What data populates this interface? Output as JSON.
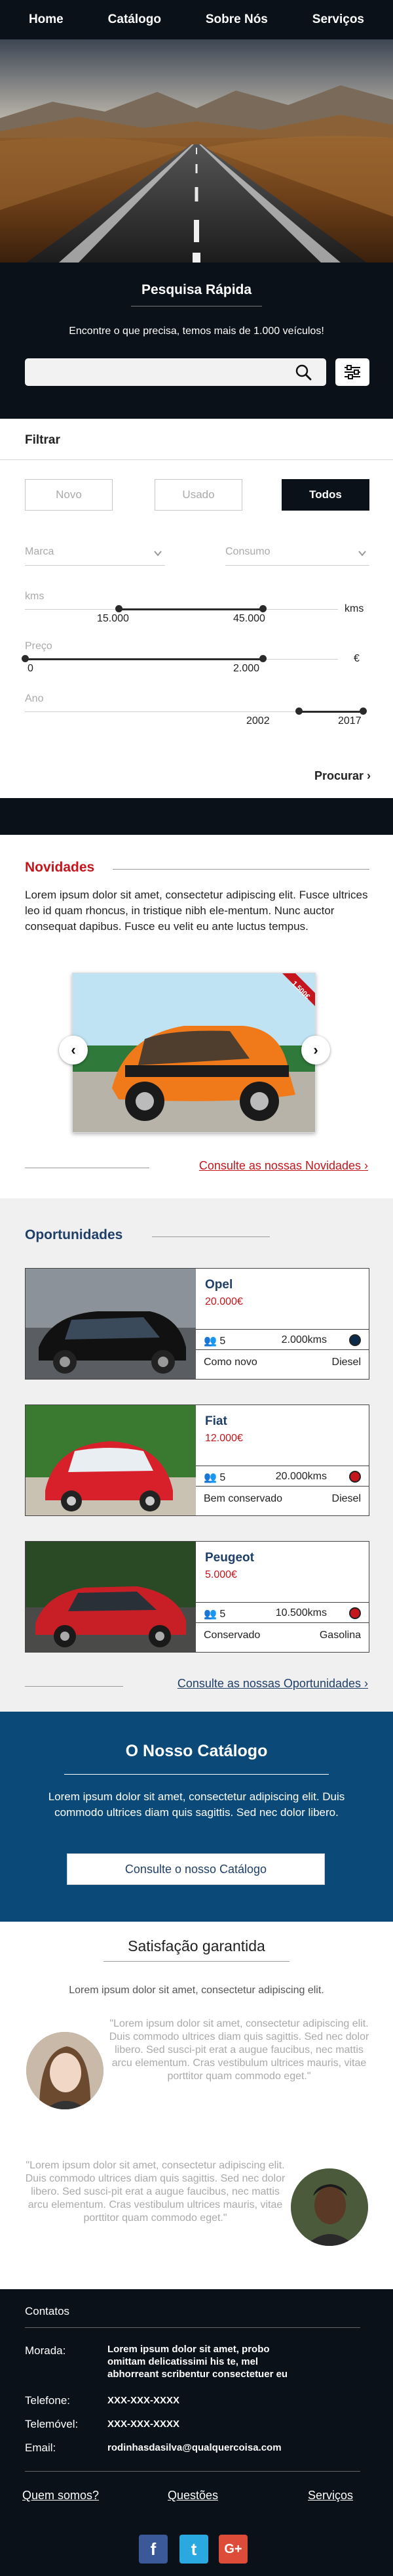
{
  "nav": {
    "items": [
      "Home",
      "Catálogo",
      "Sobre Nós",
      "Serviços"
    ]
  },
  "quick_search": {
    "title": "Pesquisa Rápida",
    "subtitle": "Encontre o que precisa, temos mais de 1.000 veículos!",
    "placeholder": ""
  },
  "filter": {
    "title": "Filtrar",
    "segments": [
      "Novo",
      "Usado",
      "Todos"
    ],
    "active_segment": "Todos",
    "marca_label": "Marca",
    "consumo_label": "Consumo",
    "kms": {
      "label": "kms",
      "unit": "kms",
      "min": "15.000",
      "max": "45.000",
      "range_fraction": [
        0.3,
        0.76
      ]
    },
    "preco": {
      "label": "Preço",
      "unit": "€",
      "min": "0",
      "max": "2.000",
      "range_fraction": [
        0.0,
        0.76
      ]
    },
    "ano": {
      "label": "Ano",
      "min": "2002",
      "max": "2017",
      "range_fraction": [
        0.81,
        1.0
      ]
    },
    "search_label": "Procurar"
  },
  "novidades": {
    "title": "Novidades",
    "text": "Lorem ipsum dolor sit amet, consectetur adipiscing elit. Fusce ultrices leo id quam rhoncus, in tristique nibh ele-mentum. Nunc auctor consequat dapibus. Fusce eu velit eu ante luctus tempus.",
    "ribbon": "1.500€",
    "link": "Consulte as nossas Novidades",
    "prev": "‹",
    "next": "›"
  },
  "oportunidades": {
    "title": "Oportunidades",
    "cards": [
      {
        "brand": "Opel",
        "price": "20.000€",
        "seats": "5",
        "km": "2.000kms",
        "condition": "Como novo",
        "fuel": "Diesel",
        "dot_color": "#0b2a4a"
      },
      {
        "brand": "Fiat",
        "price": "12.000€",
        "seats": "5",
        "km": "20.000kms",
        "condition": "Bem conservado",
        "fuel": "Diesel",
        "dot_color": "#c4161c"
      },
      {
        "brand": "Peugeot",
        "price": "5.000€",
        "seats": "5",
        "km": "10.500kms",
        "condition": "Conservado",
        "fuel": "Gasolina",
        "dot_color": "#c4161c"
      }
    ],
    "link": "Consulte as nossas Oportunidades"
  },
  "catalogo": {
    "title": "O Nosso Catálogo",
    "text": "Lorem ipsum dolor sit amet, consectetur adipiscing elit. Duis commodo ultrices diam quis sagittis. Sed nec dolor libero.",
    "button": "Consulte o nosso Catálogo"
  },
  "satisfacao": {
    "title": "Satisfação garantida",
    "subtitle": "Lorem ipsum dolor sit amet, consectetur adipiscing elit.",
    "quote1": "\"Lorem ipsum dolor sit amet, consectetur adipiscing elit. Duis commodo ultrices diam quis sagittis. Sed nec dolor libero. Sed susci-pit erat a augue faucibus, nec mattis arcu elementum. Cras vestibulum ultrices mauris, vitae porttitor quam commodo eget.\"",
    "quote2": "\"Lorem ipsum dolor sit amet, consectetur adipiscing elit. Duis commodo ultrices diam quis sagittis. Sed nec dolor libero. Sed susci-pit erat a augue faucibus, nec mattis arcu elementum. Cras vestibulum ultrices mauris, vitae porttitor quam commodo eget.\""
  },
  "footer": {
    "contacts_title": "Contatos",
    "morada_label": "Morada:",
    "morada_value": "Lorem ipsum dolor sit amet, probo omittam delicatissimi his te, mel abhorreant scribentur consectetuer eu",
    "telefone_label": "Telefone:",
    "telefone_value": "XXX-XXX-XXXX",
    "telemovel_label": "Telemóvel:",
    "telemovel_value": "XXX-XXX-XXXX",
    "email_label": "Email:",
    "email_value": "rodinhasdasilva@qualquercoisa.com",
    "links": [
      "Quem somos?",
      "Questões",
      "Serviços"
    ],
    "social": [
      {
        "name": "facebook",
        "glyph": "f",
        "color": "#3b5998"
      },
      {
        "name": "twitter",
        "glyph": "t",
        "color": "#2aa9e0"
      },
      {
        "name": "google-plus",
        "glyph": "G+",
        "color": "#dd4b39"
      }
    ]
  },
  "colors": {
    "dark": "#0b1118",
    "navy": "#1f3f68",
    "red": "#c4161c",
    "catalog_blue": "#0b4a78",
    "light_gray": "#f0f0f0"
  }
}
